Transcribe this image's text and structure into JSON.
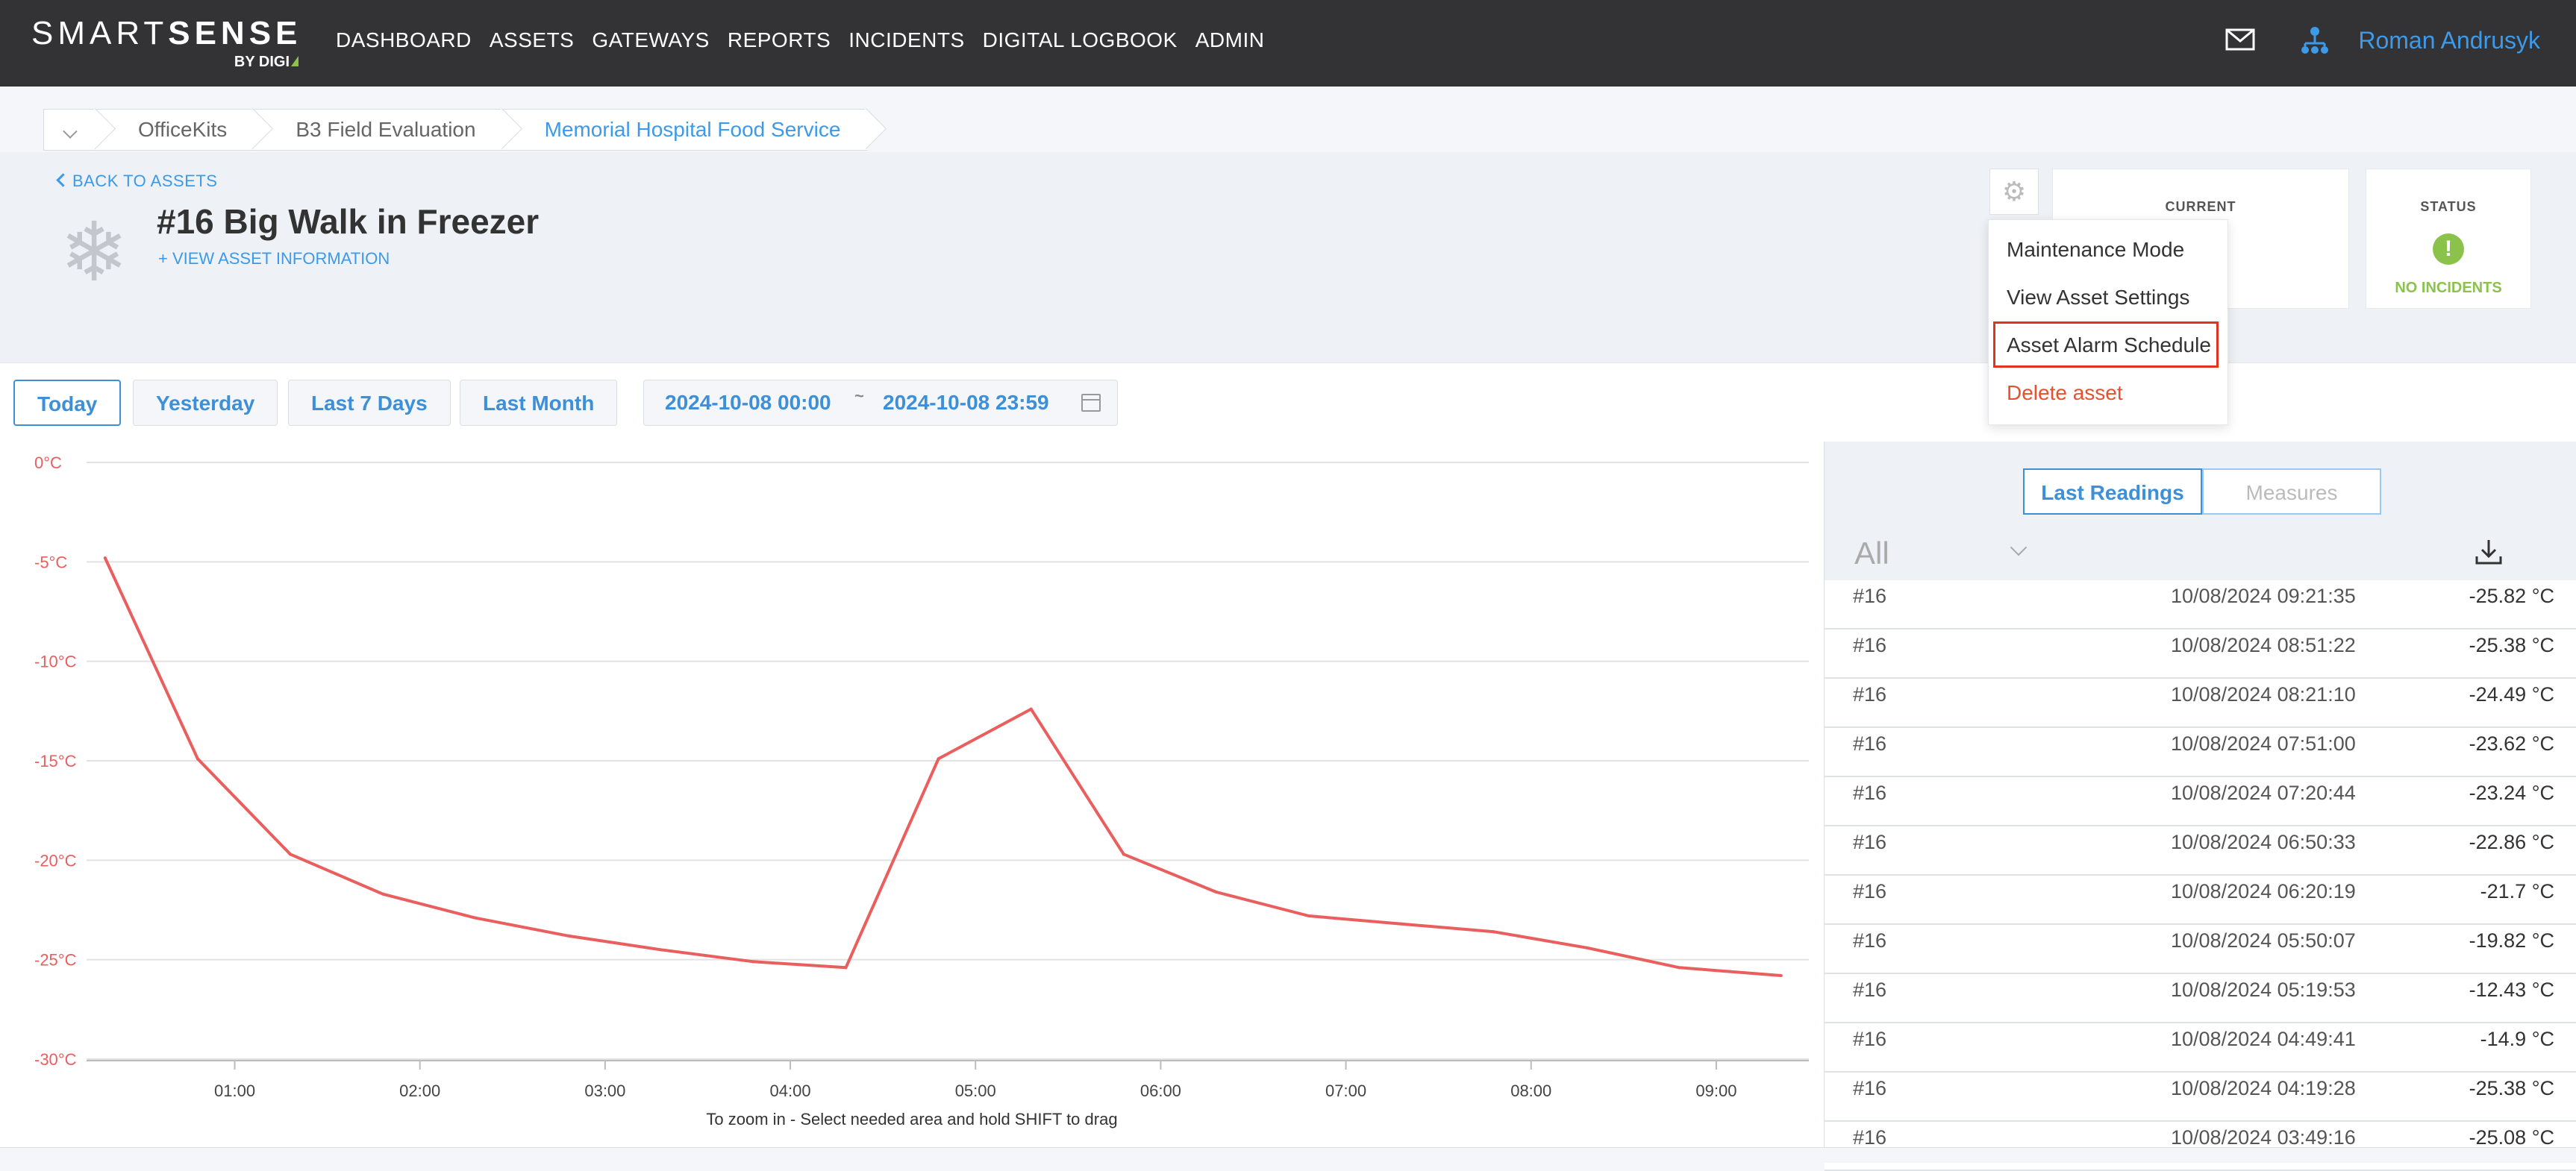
{
  "brand": {
    "name_light": "SMART",
    "name_bold": "SENSE",
    "by": "BY DIGI"
  },
  "nav": [
    "DASHBOARD",
    "ASSETS",
    "GATEWAYS",
    "REPORTS",
    "INCIDENTS",
    "DIGITAL LOGBOOK",
    "ADMIN"
  ],
  "user": {
    "name": "Roman Andrusyk"
  },
  "breadcrumbs": [
    "OfficeKits",
    "B3 Field Evaluation",
    "Memorial Hospital Food Service"
  ],
  "asset": {
    "back_label": "BACK TO ASSETS",
    "title": "#16 Big Walk in Freezer",
    "view_info": "+ VIEW ASSET INFORMATION"
  },
  "cards": {
    "current_label": "CURRENT",
    "status_label": "STATUS",
    "status_value": "NO INCIDENTS"
  },
  "menu": {
    "items": [
      "Maintenance Mode",
      "View Asset Settings",
      "Asset Alarm Schedule",
      "Delete asset"
    ]
  },
  "filters": {
    "buttons": [
      "Today",
      "Yesterday",
      "Last 7 Days",
      "Last Month"
    ],
    "from": "2024-10-08 00:00",
    "sep": "~",
    "to": "2024-10-08 23:59"
  },
  "chart_data": {
    "type": "line",
    "y_ticks": [
      "0°C",
      "-5°C",
      "-10°C",
      "-15°C",
      "-20°C",
      "-25°C",
      "-30°C"
    ],
    "ylim": [
      -30,
      0
    ],
    "x_ticks": [
      "01:00",
      "02:00",
      "03:00",
      "04:00",
      "05:00",
      "06:00",
      "07:00",
      "08:00",
      "09:00"
    ],
    "xlim": [
      0.2,
      9.5
    ],
    "x": [
      0.3,
      0.8,
      1.3,
      1.8,
      2.3,
      2.8,
      3.3,
      3.8,
      4.3,
      4.8,
      5.3,
      5.8,
      6.3,
      6.8,
      7.3,
      7.8,
      8.3,
      8.8,
      9.35
    ],
    "values": [
      -4.8,
      -14.9,
      -19.7,
      -21.7,
      -22.9,
      -23.8,
      -24.5,
      -25.1,
      -25.4,
      -14.9,
      -12.4,
      -19.7,
      -21.6,
      -22.8,
      -23.2,
      -23.6,
      -24.4,
      -25.4,
      -25.8
    ],
    "series_color": "#ea5e5e",
    "hint": "To zoom in - Select needed area and hold SHIFT to drag"
  },
  "readings": {
    "tabs": [
      "Last Readings",
      "Measures"
    ],
    "filter": "All",
    "rows": [
      {
        "id": "#16",
        "time": "10/08/2024 09:21:35",
        "value": "-25.82 °C"
      },
      {
        "id": "#16",
        "time": "10/08/2024 08:51:22",
        "value": "-25.38 °C"
      },
      {
        "id": "#16",
        "time": "10/08/2024 08:21:10",
        "value": "-24.49 °C"
      },
      {
        "id": "#16",
        "time": "10/08/2024 07:51:00",
        "value": "-23.62 °C"
      },
      {
        "id": "#16",
        "time": "10/08/2024 07:20:44",
        "value": "-23.24 °C"
      },
      {
        "id": "#16",
        "time": "10/08/2024 06:50:33",
        "value": "-22.86 °C"
      },
      {
        "id": "#16",
        "time": "10/08/2024 06:20:19",
        "value": "-21.7 °C"
      },
      {
        "id": "#16",
        "time": "10/08/2024 05:50:07",
        "value": "-19.82 °C"
      },
      {
        "id": "#16",
        "time": "10/08/2024 05:19:53",
        "value": "-12.43 °C"
      },
      {
        "id": "#16",
        "time": "10/08/2024 04:49:41",
        "value": "-14.9 °C"
      },
      {
        "id": "#16",
        "time": "10/08/2024 04:19:28",
        "value": "-25.38 °C"
      },
      {
        "id": "#16",
        "time": "10/08/2024 03:49:16",
        "value": "-25.08 °C"
      }
    ]
  }
}
